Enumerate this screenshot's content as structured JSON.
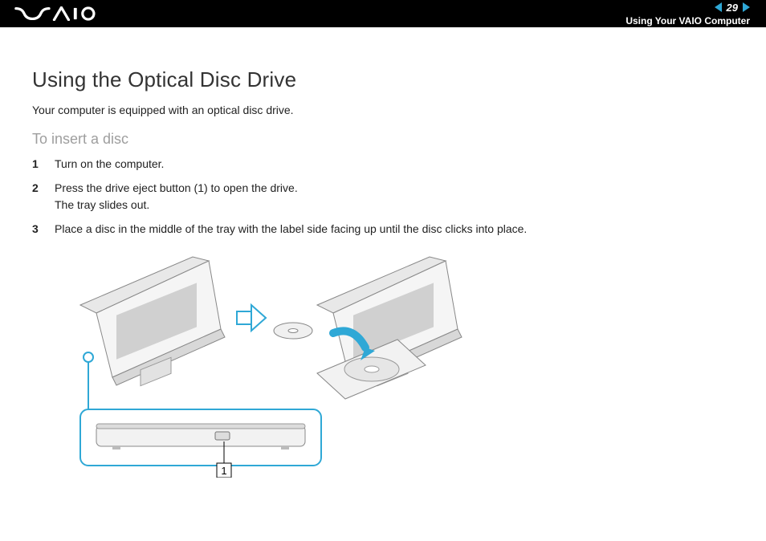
{
  "header": {
    "page_number": "29",
    "section": "Using Your VAIO Computer"
  },
  "content": {
    "title": "Using the Optical Disc Drive",
    "intro": "Your computer is equipped with an optical disc drive.",
    "sub_heading": "To insert a disc",
    "steps": [
      "Turn on the computer.",
      "Press the drive eject button (1) to open the drive.\nThe tray slides out.",
      "Place a disc in the middle of the tray with the label side facing up until the disc clicks into place."
    ],
    "callout_label": "1"
  }
}
